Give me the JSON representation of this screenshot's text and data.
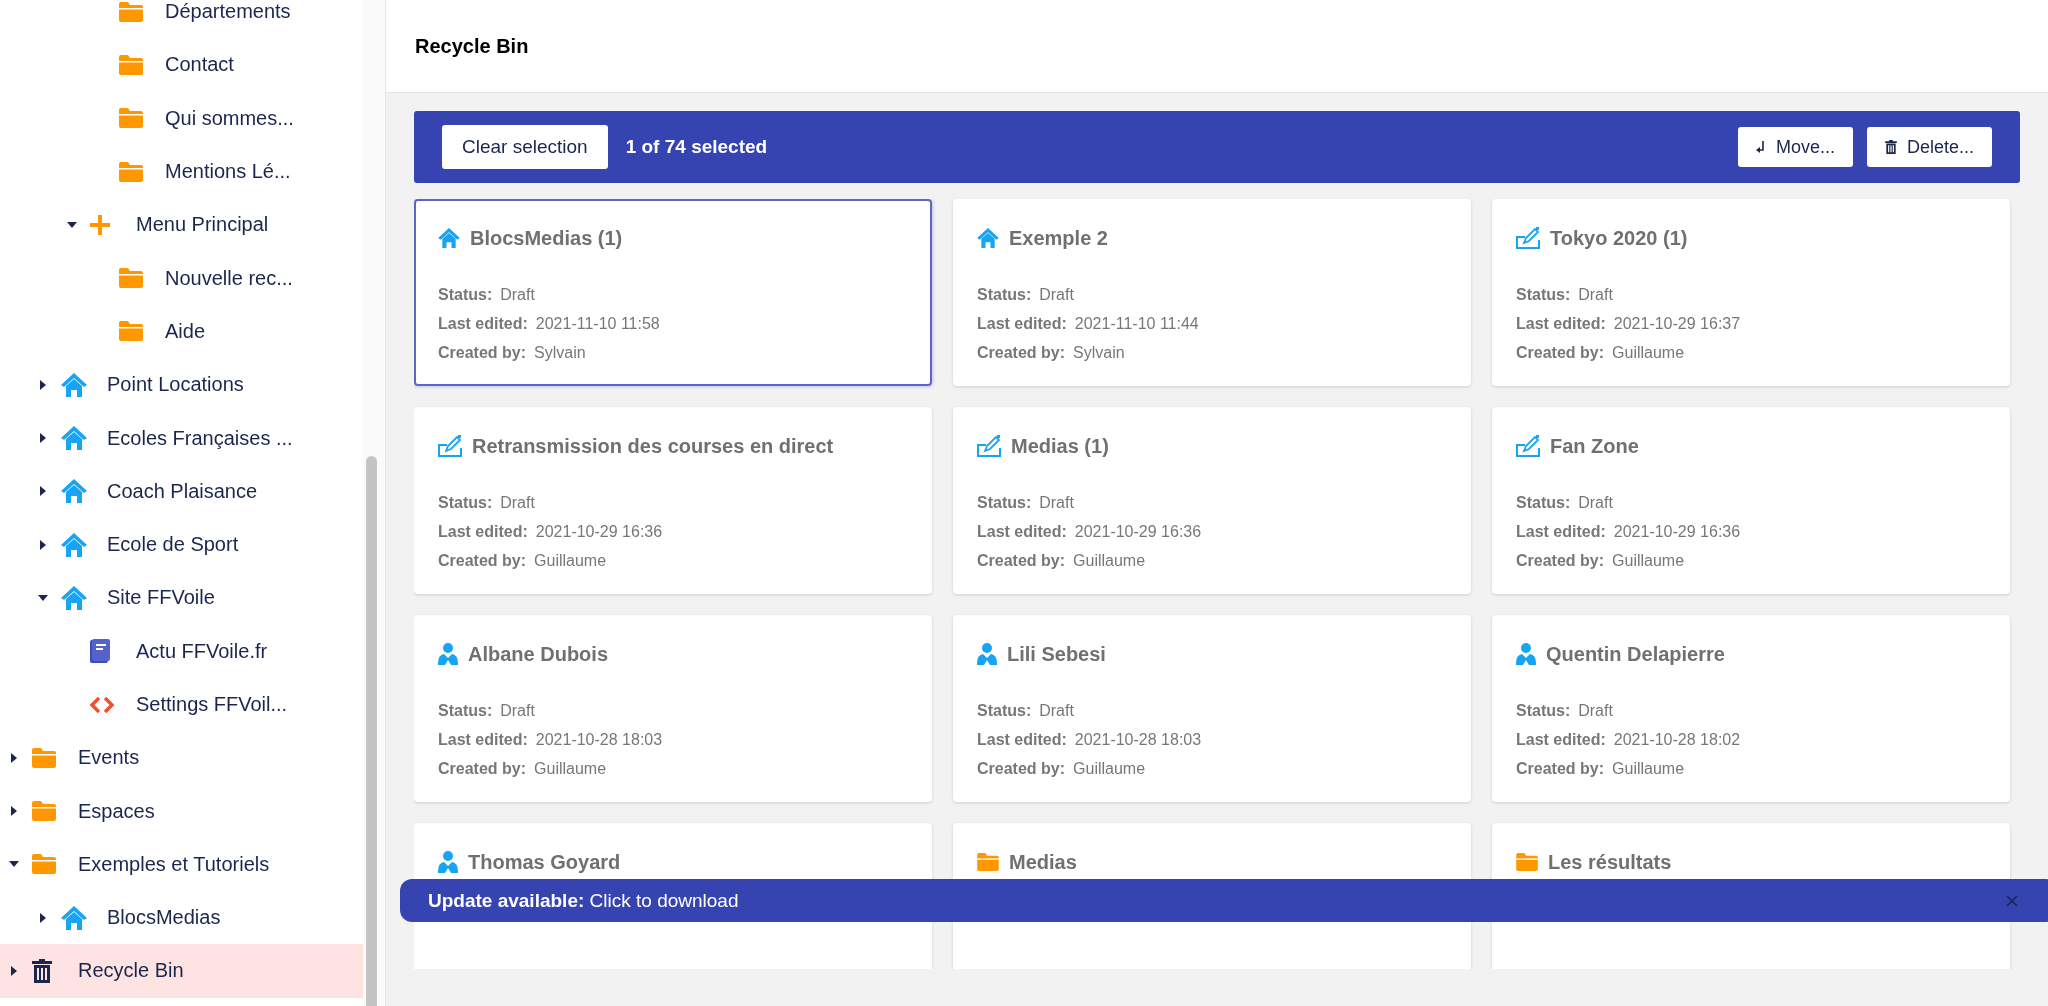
{
  "sidebar": {
    "tree": [
      {
        "children": [
          {
            "children": [
              {
                "children": [
                  {
                    "label": "Départements",
                    "kind": "folder",
                    "selected": false
                  },
                  {
                    "label": "Contact",
                    "kind": "folder",
                    "selected": false
                  },
                  {
                    "label": "Qui sommes...",
                    "kind": "folder",
                    "selected": false
                  },
                  {
                    "label": "Mentions Lé...",
                    "kind": "folder",
                    "selected": false
                  }
                ]
              },
              {
                "label": "Menu Principal",
                "kind": "plus",
                "expanded": true,
                "selected": false,
                "children": [
                  {
                    "label": "Nouvelle rec...",
                    "kind": "folder",
                    "selected": false
                  },
                  {
                    "label": "Aide",
                    "kind": "folder",
                    "selected": false
                  }
                ]
              }
            ]
          },
          {
            "label": "Point Locations",
            "kind": "house",
            "expanded": false,
            "selected": false
          },
          {
            "label": "Ecoles Françaises ...",
            "kind": "house",
            "expanded": false,
            "selected": false
          },
          {
            "label": "Coach Plaisance",
            "kind": "house",
            "expanded": false,
            "selected": false
          },
          {
            "label": "Ecole de Sport",
            "kind": "house",
            "expanded": false,
            "selected": false
          },
          {
            "label": "Site FFVoile",
            "kind": "house",
            "expanded": true,
            "selected": false,
            "children": [
              {
                "label": "Actu FFVoile.fr",
                "kind": "book",
                "selected": false
              },
              {
                "label": "Settings FFVoil...",
                "kind": "code",
                "selected": false
              }
            ]
          }
        ]
      },
      {
        "label": "Events",
        "kind": "folder",
        "expanded": false,
        "selected": false
      },
      {
        "label": "Espaces",
        "kind": "folder",
        "expanded": false,
        "selected": false
      },
      {
        "label": "Exemples et Tutoriels",
        "kind": "folder",
        "expanded": true,
        "selected": false,
        "children": [
          {
            "label": "BlocsMedias",
            "kind": "house",
            "expanded": false,
            "selected": false
          }
        ]
      },
      {
        "label": "Recycle Bin",
        "kind": "trash",
        "expanded": false,
        "selected": true
      }
    ]
  },
  "header": {
    "title": "Recycle Bin"
  },
  "toolbar": {
    "clear_button": "Clear selection",
    "selection_count": "1 of 74 selected",
    "move_button": "Move...",
    "delete_button": "Delete..."
  },
  "cards": [
    {
      "title": "BlocsMedias (1)",
      "kind": "house",
      "selected": true,
      "fields": [
        {
          "label": "Status:",
          "value": "Draft"
        },
        {
          "label": "Last edited:",
          "value": "2021-11-10 11:58"
        },
        {
          "label": "Created by:",
          "value": "Sylvain"
        }
      ]
    },
    {
      "title": "Exemple 2",
      "kind": "house",
      "selected": false,
      "fields": [
        {
          "label": "Status:",
          "value": "Draft"
        },
        {
          "label": "Last edited:",
          "value": "2021-11-10 11:44"
        },
        {
          "label": "Created by:",
          "value": "Sylvain"
        }
      ]
    },
    {
      "title": "Tokyo 2020 (1)",
      "kind": "edit",
      "selected": false,
      "fields": [
        {
          "label": "Status:",
          "value": "Draft"
        },
        {
          "label": "Last edited:",
          "value": "2021-10-29 16:37"
        },
        {
          "label": "Created by:",
          "value": "Guillaume"
        }
      ]
    },
    {
      "title": "Retransmission des courses en direct",
      "kind": "edit",
      "selected": false,
      "fields": [
        {
          "label": "Status:",
          "value": "Draft"
        },
        {
          "label": "Last edited:",
          "value": "2021-10-29 16:36"
        },
        {
          "label": "Created by:",
          "value": "Guillaume"
        }
      ]
    },
    {
      "title": "Medias (1)",
      "kind": "edit",
      "selected": false,
      "fields": [
        {
          "label": "Status:",
          "value": "Draft"
        },
        {
          "label": "Last edited:",
          "value": "2021-10-29 16:36"
        },
        {
          "label": "Created by:",
          "value": "Guillaume"
        }
      ]
    },
    {
      "title": "Fan Zone",
      "kind": "edit",
      "selected": false,
      "fields": [
        {
          "label": "Status:",
          "value": "Draft"
        },
        {
          "label": "Last edited:",
          "value": "2021-10-29 16:36"
        },
        {
          "label": "Created by:",
          "value": "Guillaume"
        }
      ]
    },
    {
      "title": "Albane Dubois",
      "kind": "person",
      "selected": false,
      "fields": [
        {
          "label": "Status:",
          "value": "Draft"
        },
        {
          "label": "Last edited:",
          "value": "2021-10-28 18:03"
        },
        {
          "label": "Created by:",
          "value": "Guillaume"
        }
      ]
    },
    {
      "title": "Lili Sebesi",
      "kind": "person",
      "selected": false,
      "fields": [
        {
          "label": "Status:",
          "value": "Draft"
        },
        {
          "label": "Last edited:",
          "value": "2021-10-28 18:03"
        },
        {
          "label": "Created by:",
          "value": "Guillaume"
        }
      ]
    },
    {
      "title": "Quentin Delapierre",
      "kind": "person",
      "selected": false,
      "fields": [
        {
          "label": "Status:",
          "value": "Draft"
        },
        {
          "label": "Last edited:",
          "value": "2021-10-28 18:02"
        },
        {
          "label": "Created by:",
          "value": "Guillaume"
        }
      ]
    },
    {
      "title": "Thomas Goyard",
      "kind": "person",
      "selected": false
    },
    {
      "title": "Medias",
      "kind": "folder",
      "selected": false
    },
    {
      "title": "Les résultats",
      "kind": "folder",
      "selected": false
    }
  ],
  "banner": {
    "text": "**Update available:** Click to download"
  }
}
